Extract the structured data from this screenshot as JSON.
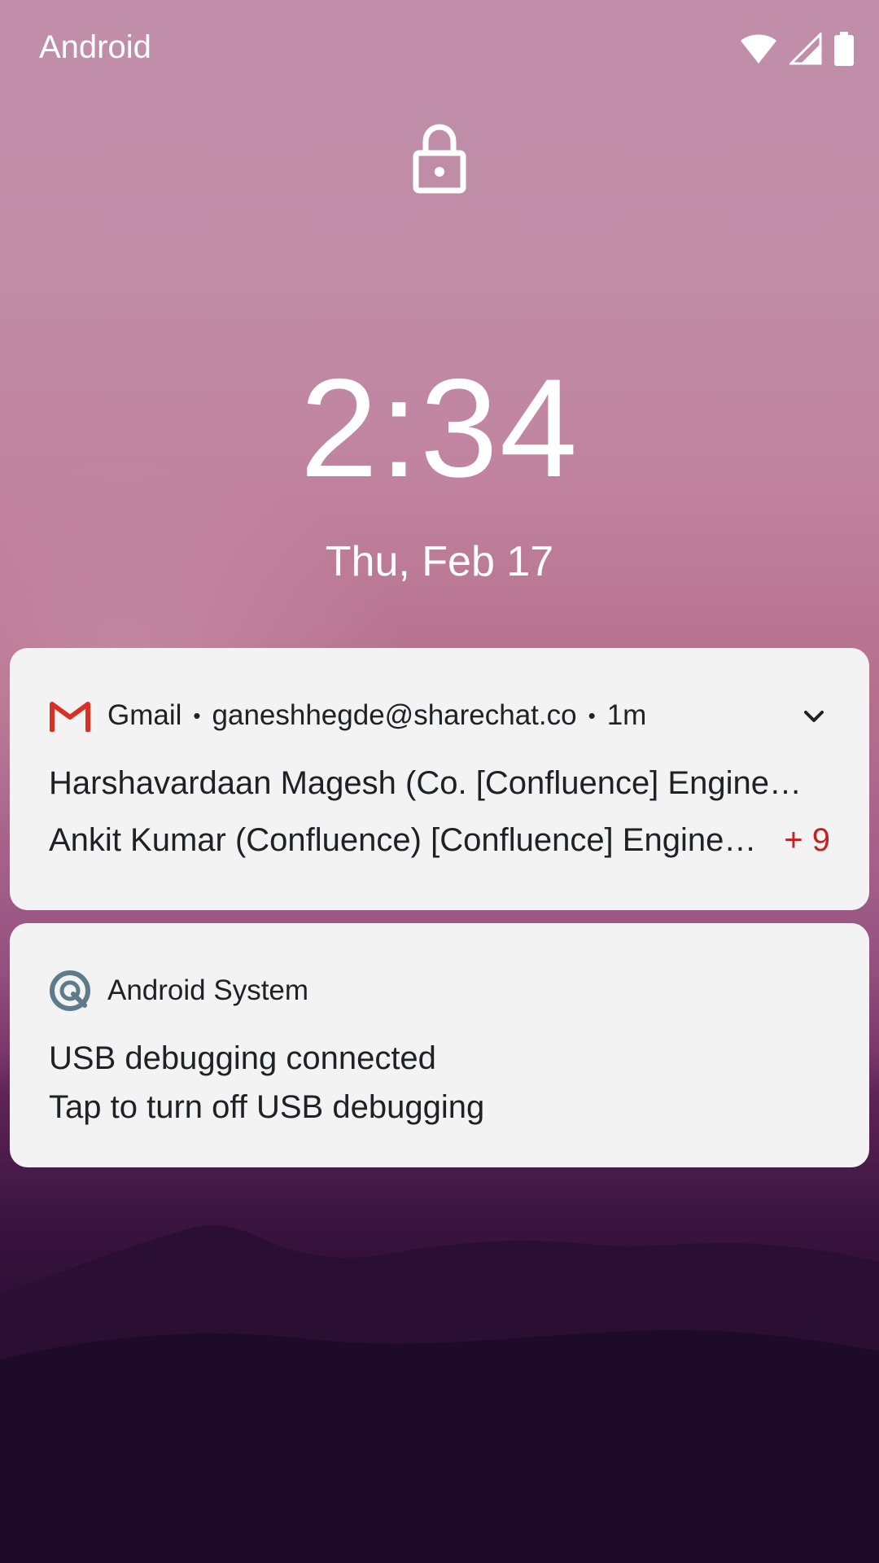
{
  "status_bar": {
    "carrier": "Android",
    "icons": [
      "wifi-icon",
      "cell-signal-icon",
      "battery-icon"
    ]
  },
  "lock_icon": "lock-icon",
  "clock": {
    "time": "2:34",
    "date": "Thu, Feb 17"
  },
  "notifications": [
    {
      "app_icon": "gmail-icon",
      "app_name": "Gmail",
      "account": "ganeshhegde@sharechat.co",
      "time": "1m",
      "separator": "•",
      "lines": [
        "Harshavardaan Magesh (Co. [Confluence] Engine…",
        "Ankit Kumar (Confluence) [Confluence] Engine…"
      ],
      "more_count": "+ 9",
      "expand_icon": "chevron-down-icon",
      "accent_color": "#c5221f"
    },
    {
      "app_icon": "android-system-icon",
      "app_name": "Android System",
      "lines": [
        "USB debugging connected",
        "Tap to turn off USB debugging"
      ]
    }
  ],
  "colors": {
    "card_background": "#f3f3f3",
    "wallpaper_top": "#c08ea9",
    "wallpaper_bottom": "#12061c"
  }
}
